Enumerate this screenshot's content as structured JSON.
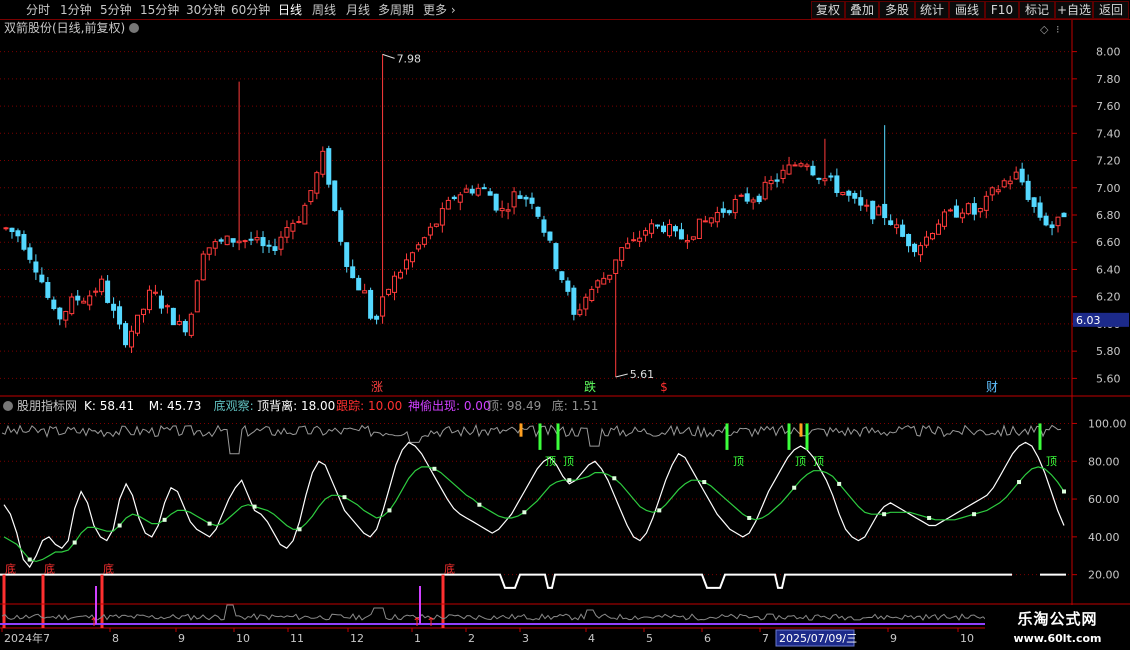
{
  "toolbar": {
    "periods": [
      "分时",
      "1分钟",
      "5分钟",
      "15分钟",
      "30分钟",
      "60分钟",
      "日线",
      "周线",
      "月线",
      "多周期"
    ],
    "active_period": "日线",
    "more_label": "更多",
    "more_icon": "chevron-right-icon",
    "buttons": [
      "复权",
      "叠加",
      "多股",
      "统计",
      "画线",
      "F10",
      "标记",
      "+自选",
      "返回"
    ]
  },
  "main_panel": {
    "title": "双箭股份(日线,前复权)",
    "title_icon": "chevron-down-circle-icon",
    "corner_icon": "diamond-icon",
    "current_price_tag": "6.03",
    "high_label": "7.98",
    "low_label": "5.61",
    "event_markers": [
      {
        "label": "涨",
        "color": "#ff4040"
      },
      {
        "label": "跌",
        "color": "#60ff60"
      },
      {
        "label": "$",
        "color": "#ff3030"
      },
      {
        "label": "财",
        "color": "#60c0ff"
      }
    ],
    "colors": {
      "up": "#ff3b3b",
      "down": "#55d8ff",
      "grid": "#7a0000",
      "axis": "#c00000"
    }
  },
  "indicator_panel": {
    "title": "股朋指标网",
    "title_icon": "chevron-down-circle-icon",
    "stats": [
      {
        "label": "K:",
        "value": "58.41",
        "color": "#ffffff"
      },
      {
        "label": "M:",
        "value": "45.73",
        "color": "#ffffff"
      },
      {
        "label": "底观察:",
        "value": "",
        "color": "#60c0c0"
      },
      {
        "label": "顶背离:",
        "value": "18.00",
        "color": "#ffffff"
      },
      {
        "label": "跟踪:",
        "value": "10.00",
        "color": "#ff3030"
      },
      {
        "label": "神偷出现:",
        "value": "0.00",
        "color": "#d040ff"
      },
      {
        "label": "顶:",
        "value": "98.49",
        "color": "#909090"
      },
      {
        "label": "底:",
        "value": "1.51",
        "color": "#909090"
      }
    ],
    "signal_labels": {
      "top": "顶",
      "bottom": "底"
    }
  },
  "x_axis": {
    "labels": [
      "2024年7",
      "8",
      "9",
      "10",
      "11",
      "12",
      "1",
      "2",
      "3",
      "4",
      "5",
      "6",
      "7",
      "9",
      "10"
    ],
    "cursor_date": "2025/07/09/三"
  },
  "chart_data": [
    {
      "type": "candlestick",
      "title": "双箭股份(日线,前复权)",
      "ylim": [
        5.5,
        8.1
      ],
      "yticks": [
        "8.00",
        "7.80",
        "7.60",
        "7.40",
        "7.20",
        "7.00",
        "6.80",
        "6.60",
        "6.40",
        "6.20",
        "6.00",
        "5.80",
        "5.60"
      ],
      "high": 7.98,
      "low": 5.61,
      "last": 6.03
    },
    {
      "type": "line",
      "title": "股朋指标网",
      "ylim": [
        14,
        105
      ],
      "yticks": [
        "100.00",
        "80.00",
        "60.00",
        "40.00",
        "20.00"
      ],
      "series": [
        {
          "name": "K",
          "color": "#ffffff",
          "values": [
            57,
            52,
            42,
            28,
            24,
            30,
            38,
            40,
            36,
            34,
            38,
            55,
            64,
            58,
            46,
            40,
            38,
            44,
            60,
            68,
            62,
            50,
            42,
            40,
            46,
            58,
            66,
            64,
            56,
            48,
            44,
            42,
            40,
            44,
            52,
            60,
            66,
            70,
            62,
            54,
            52,
            48,
            42,
            36,
            34,
            38,
            48,
            62,
            74,
            80,
            78,
            70,
            62,
            54,
            50,
            46,
            42,
            40,
            44,
            54,
            66,
            78,
            86,
            90,
            88,
            84,
            78,
            72,
            66,
            60,
            55,
            52,
            50,
            48,
            46,
            44,
            42,
            44,
            48,
            52,
            58,
            64,
            70,
            76,
            80,
            82,
            78,
            72,
            68,
            70,
            74,
            78,
            80,
            76,
            70,
            62,
            54,
            46,
            40,
            38,
            42,
            50,
            60,
            70,
            78,
            84,
            82,
            76,
            70,
            64,
            58,
            52,
            48,
            44,
            42,
            40,
            42,
            48,
            56,
            64,
            70,
            76,
            82,
            86,
            88,
            86,
            82,
            76,
            70,
            62,
            52,
            44,
            40,
            38,
            40,
            46,
            52,
            56,
            58,
            56,
            54,
            52,
            50,
            48,
            46,
            46,
            48,
            50,
            52,
            54,
            56,
            58,
            60,
            62,
            66,
            72,
            78,
            84,
            88,
            90,
            88,
            82,
            74,
            64,
            54,
            46
          ]
        },
        {
          "name": "M",
          "color": "#2ecc40",
          "values": [
            40,
            38,
            36,
            32,
            28,
            27,
            28,
            30,
            32,
            32,
            33,
            37,
            42,
            45,
            45,
            44,
            43,
            43,
            46,
            50,
            52,
            51,
            49,
            47,
            47,
            49,
            52,
            54,
            54,
            53,
            51,
            49,
            47,
            46,
            47,
            50,
            53,
            56,
            57,
            56,
            55,
            54,
            52,
            49,
            46,
            44,
            44,
            47,
            51,
            56,
            60,
            62,
            62,
            61,
            59,
            57,
            54,
            52,
            50,
            51,
            54,
            59,
            65,
            71,
            75,
            77,
            77,
            76,
            74,
            71,
            68,
            65,
            62,
            60,
            57,
            55,
            53,
            51,
            50,
            50,
            51,
            53,
            56,
            59,
            63,
            67,
            69,
            70,
            70,
            70,
            71,
            72,
            74,
            74,
            73,
            71,
            68,
            64,
            60,
            56,
            54,
            53,
            54,
            57,
            61,
            65,
            68,
            70,
            70,
            69,
            67,
            64,
            61,
            58,
            55,
            52,
            50,
            49,
            50,
            52,
            55,
            58,
            62,
            66,
            70,
            73,
            75,
            75,
            74,
            72,
            68,
            64,
            60,
            56,
            53,
            52,
            52,
            52,
            53,
            53,
            53,
            53,
            52,
            51,
            50,
            49,
            49,
            49,
            49,
            50,
            51,
            52,
            53,
            54,
            56,
            58,
            61,
            65,
            69,
            73,
            76,
            77,
            76,
            73,
            69,
            64
          ]
        }
      ]
    }
  ]
}
